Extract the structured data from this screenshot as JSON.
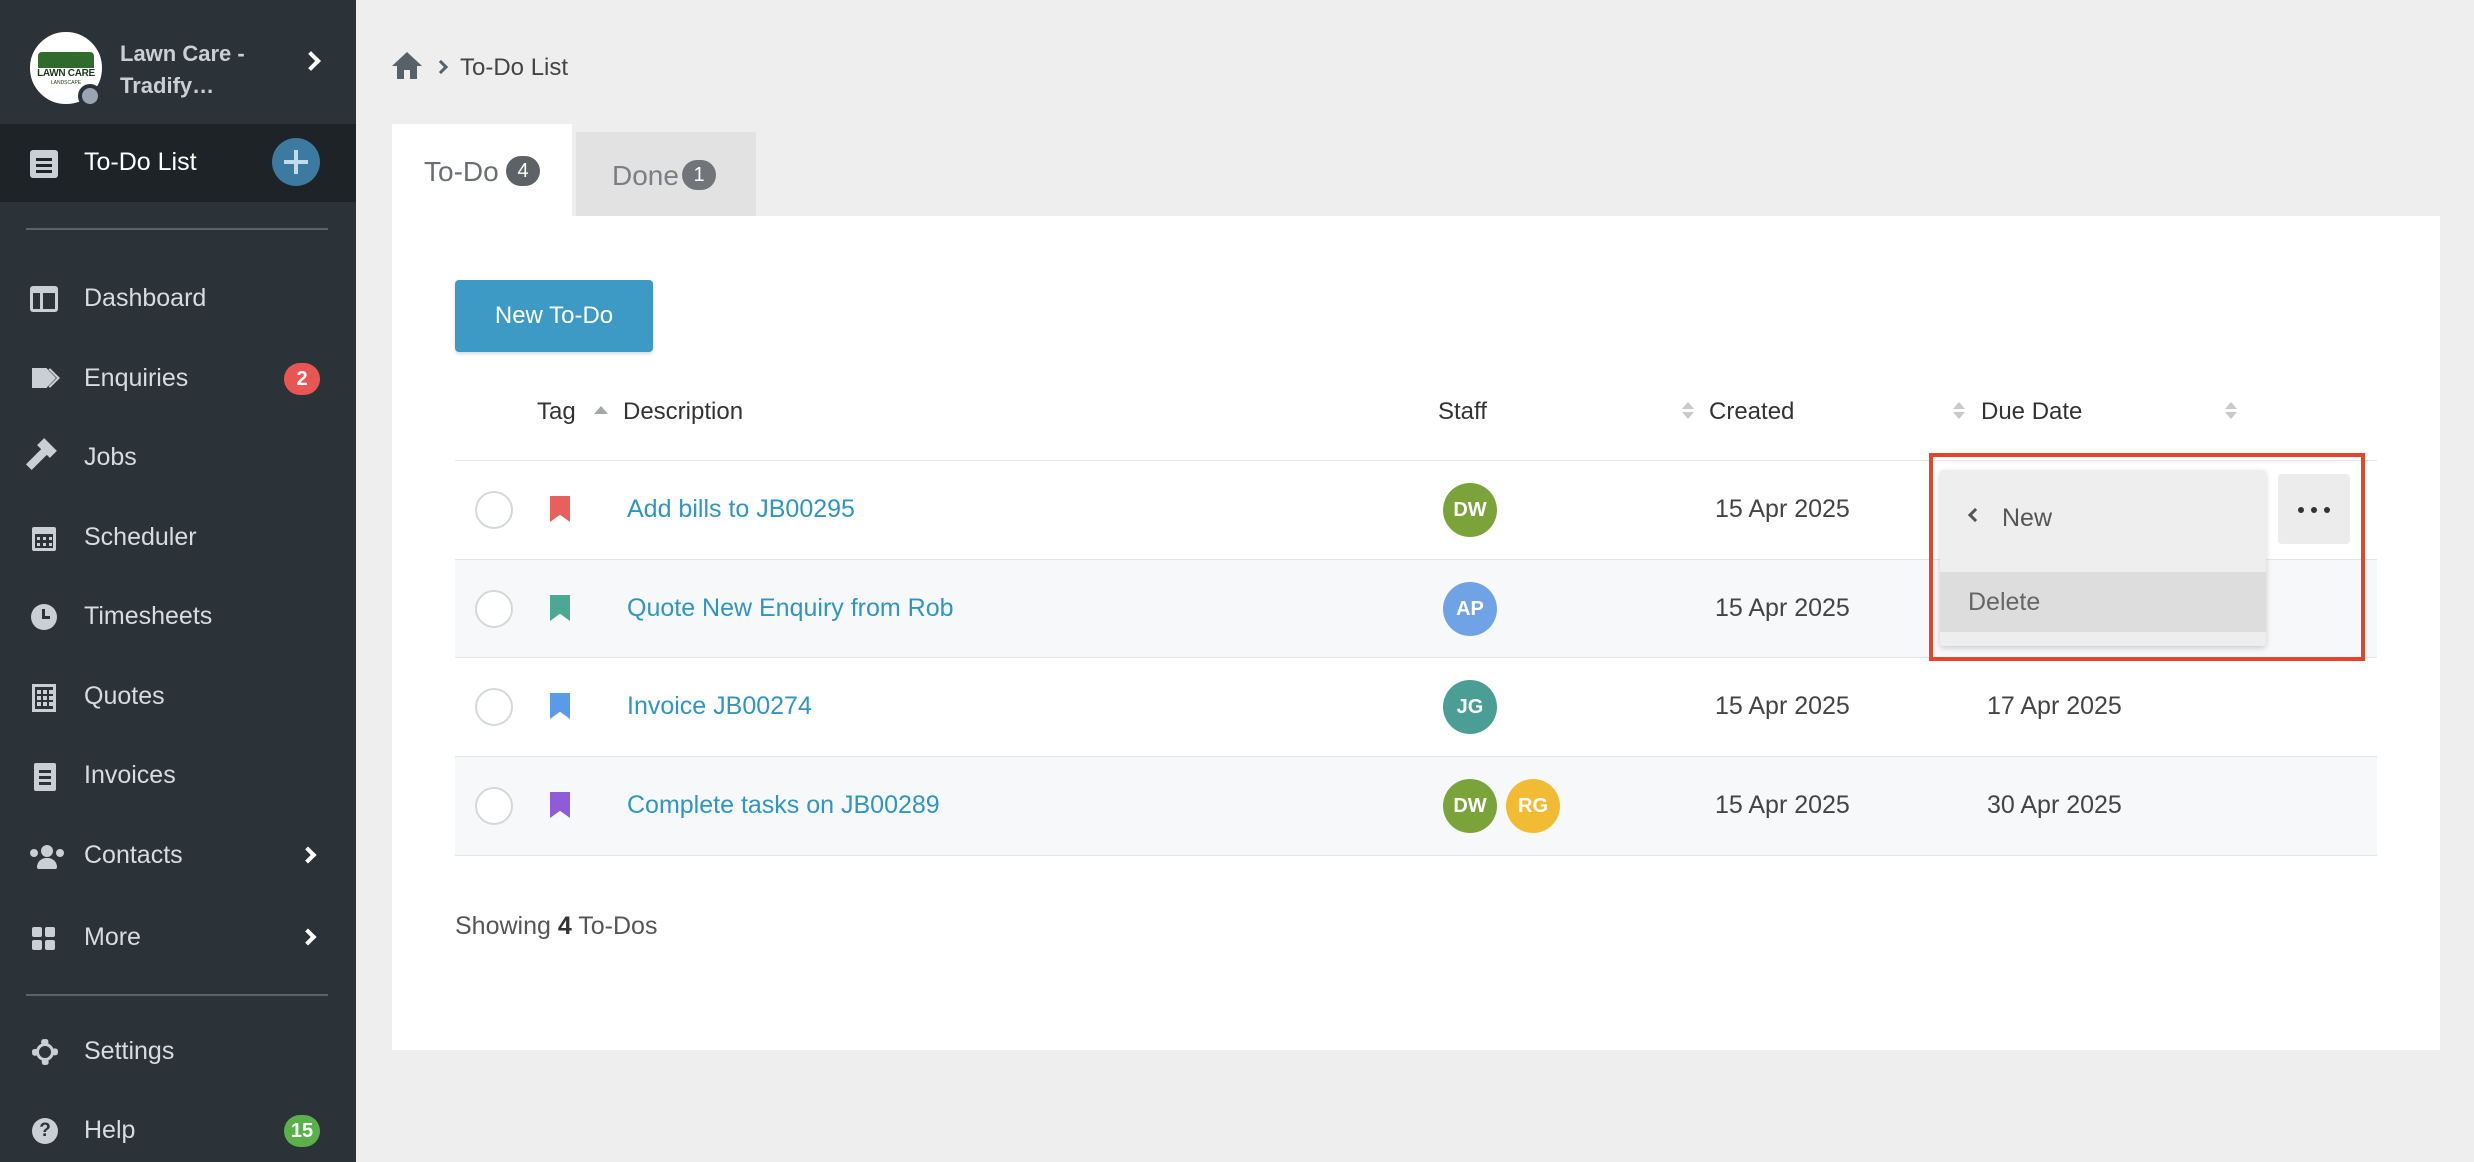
{
  "account": {
    "name": "Lawn Care - Tradify…",
    "logo_text": "LAWN CARE",
    "logo_sub": "LANDSCAPE"
  },
  "sidebar": {
    "current": {
      "label": "To-Do List"
    },
    "items": [
      {
        "label": "Dashboard",
        "icon": "dashboard-icon"
      },
      {
        "label": "Enquiries",
        "icon": "tags-icon",
        "badge": "2"
      },
      {
        "label": "Jobs",
        "icon": "hammer-icon"
      },
      {
        "label": "Scheduler",
        "icon": "calendar-icon"
      },
      {
        "label": "Timesheets",
        "icon": "clock-icon"
      },
      {
        "label": "Quotes",
        "icon": "calculator-icon"
      },
      {
        "label": "Invoices",
        "icon": "invoice-icon"
      },
      {
        "label": "Contacts",
        "icon": "users-icon"
      },
      {
        "label": "More",
        "icon": "grid-icon"
      }
    ],
    "bottom": [
      {
        "label": "Settings",
        "icon": "gear-icon"
      },
      {
        "label": "Help",
        "icon": "help-icon",
        "badge": "15"
      }
    ]
  },
  "breadcrumb": {
    "current": "To-Do List"
  },
  "tabs": [
    {
      "label": "To-Do",
      "count": "4"
    },
    {
      "label": "Done",
      "count": "1"
    }
  ],
  "toolbar": {
    "new_label": "New To-Do"
  },
  "table": {
    "headers": {
      "tag": "Tag",
      "description": "Description",
      "staff": "Staff",
      "created": "Created",
      "due": "Due Date"
    },
    "rows": [
      {
        "tag_color": "#e8605d",
        "description": "Add bills to JB00295",
        "staff": [
          {
            "initials": "DW",
            "color": "#7aa43a"
          }
        ],
        "created": "15 Apr 2025",
        "due": ""
      },
      {
        "tag_color": "#4aa893",
        "description": "Quote New Enquiry from Rob",
        "staff": [
          {
            "initials": "AP",
            "color": "#6fa3e6"
          }
        ],
        "created": "15 Apr 2025",
        "due": ""
      },
      {
        "tag_color": "#5a9be8",
        "description": "Invoice JB00274",
        "staff": [
          {
            "initials": "JG",
            "color": "#4a9e96"
          }
        ],
        "created": "15 Apr 2025",
        "due": "17 Apr 2025"
      },
      {
        "tag_color": "#8e5bd9",
        "description": "Complete tasks on JB00289",
        "staff": [
          {
            "initials": "DW",
            "color": "#7aa43a"
          },
          {
            "initials": "RG",
            "color": "#f1bb34"
          }
        ],
        "created": "15 Apr 2025",
        "due": "30 Apr 2025"
      }
    ]
  },
  "context_menu": {
    "back_label": "New",
    "delete_label": "Delete"
  },
  "footer": {
    "prefix": "Showing",
    "count": "4",
    "suffix": "To-Dos"
  },
  "colors": {
    "sidebar": "#2b3338",
    "accent": "#3c9ac4",
    "link": "#2f96c2",
    "highlight": "#e2452b"
  }
}
